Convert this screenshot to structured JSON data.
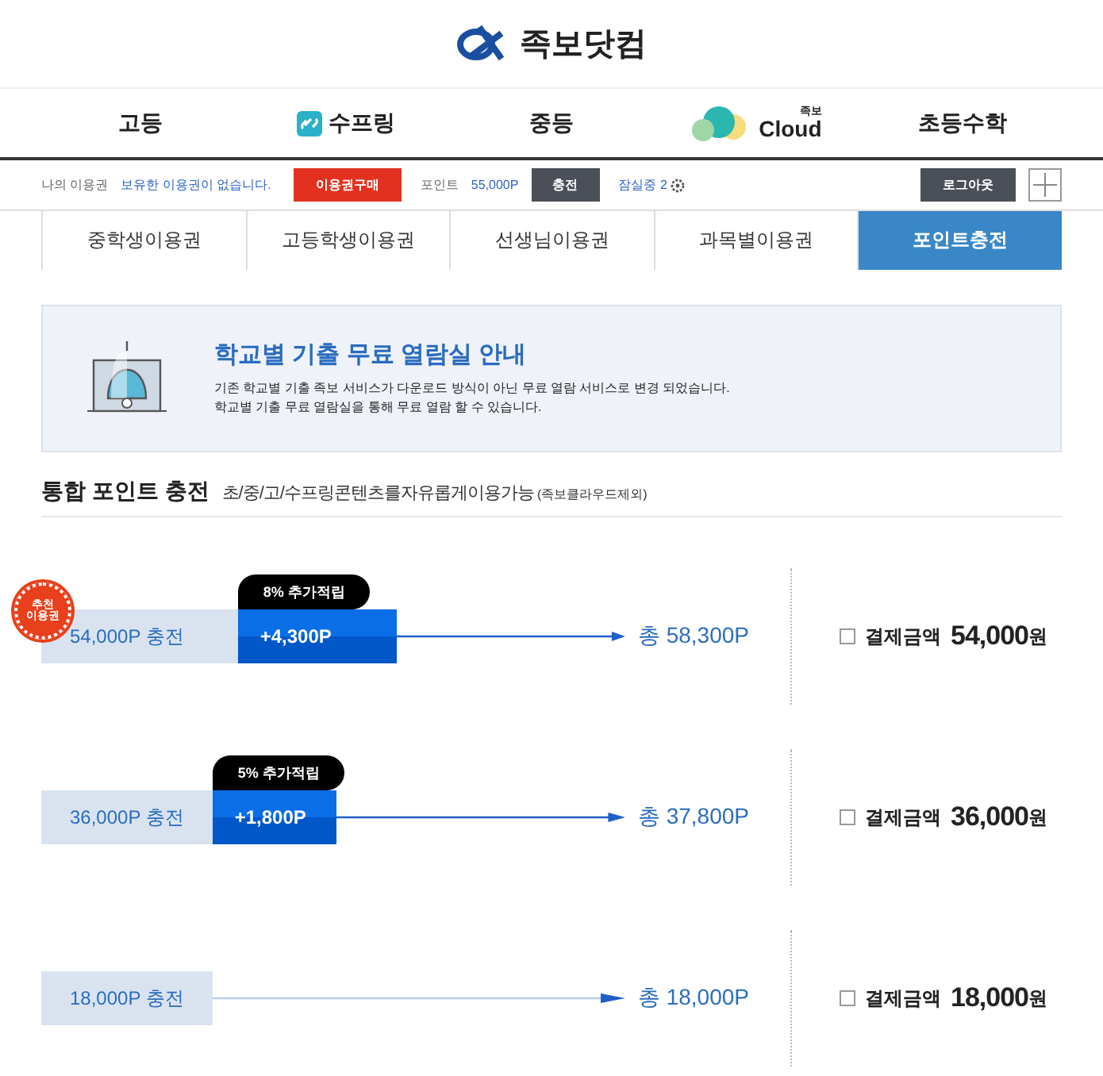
{
  "brand": "족보닷컴",
  "nav": [
    {
      "kind": "text",
      "label": "고등"
    },
    {
      "kind": "icon",
      "label": "수프링"
    },
    {
      "kind": "text",
      "label": "중등"
    },
    {
      "kind": "cloud",
      "label": "Cloud",
      "sup": "족보"
    },
    {
      "kind": "text",
      "label": "초등수학"
    }
  ],
  "account": {
    "pass_label": "나의 이용권",
    "pass_value": "보유한 이용권이 없습니다.",
    "buy_button": "이용권구매",
    "point_label": "포인트",
    "point_value": "55,000P",
    "charge_button": "충전",
    "school": "잠실중 2",
    "logout_button": "로그아웃"
  },
  "tabs": [
    {
      "label": "중학생이용권",
      "selected": false
    },
    {
      "label": "고등학생이용권",
      "selected": false
    },
    {
      "label": "선생님이용권",
      "selected": false
    },
    {
      "label": "과목별이용권",
      "selected": false
    },
    {
      "label": "포인트충전",
      "selected": true
    }
  ],
  "notice": {
    "title": "학교별 기출 무료 열람실 안내",
    "lines": [
      "기존 학교별 기출 족보 서비스가 다운로드 방식이 아닌 무료 열람 서비스로 변경 되었습니다.",
      "학교별 기출 무료 열람실을 통해 무료 열람 할 수 있습니다."
    ]
  },
  "section": {
    "title": "통합 포인트 충전",
    "subtitle": "초/중/고/수프링콘텐츠를자유롭게이용가능",
    "note": "(족보클라우드제외)"
  },
  "plans": [
    {
      "badge": "추천 이용권",
      "base": "54,000P 충전",
      "bonus_tag": "8% 추가적립",
      "bonus": "+4,300P",
      "total": "총 58,300P",
      "pay_label": "결제금액",
      "pay_amount": "54,000",
      "pay_unit": "원",
      "checked": false
    },
    {
      "base": "36,000P 충전",
      "bonus_tag": "5% 추가적립",
      "bonus": "+1,800P",
      "total": "총 37,800P",
      "pay_label": "결제금액",
      "pay_amount": "36,000",
      "pay_unit": "원",
      "checked": false
    },
    {
      "base": "18,000P 충전",
      "total": "총 18,000P",
      "pay_label": "결제금액",
      "pay_amount": "18,000",
      "pay_unit": "원",
      "checked": false
    }
  ]
}
